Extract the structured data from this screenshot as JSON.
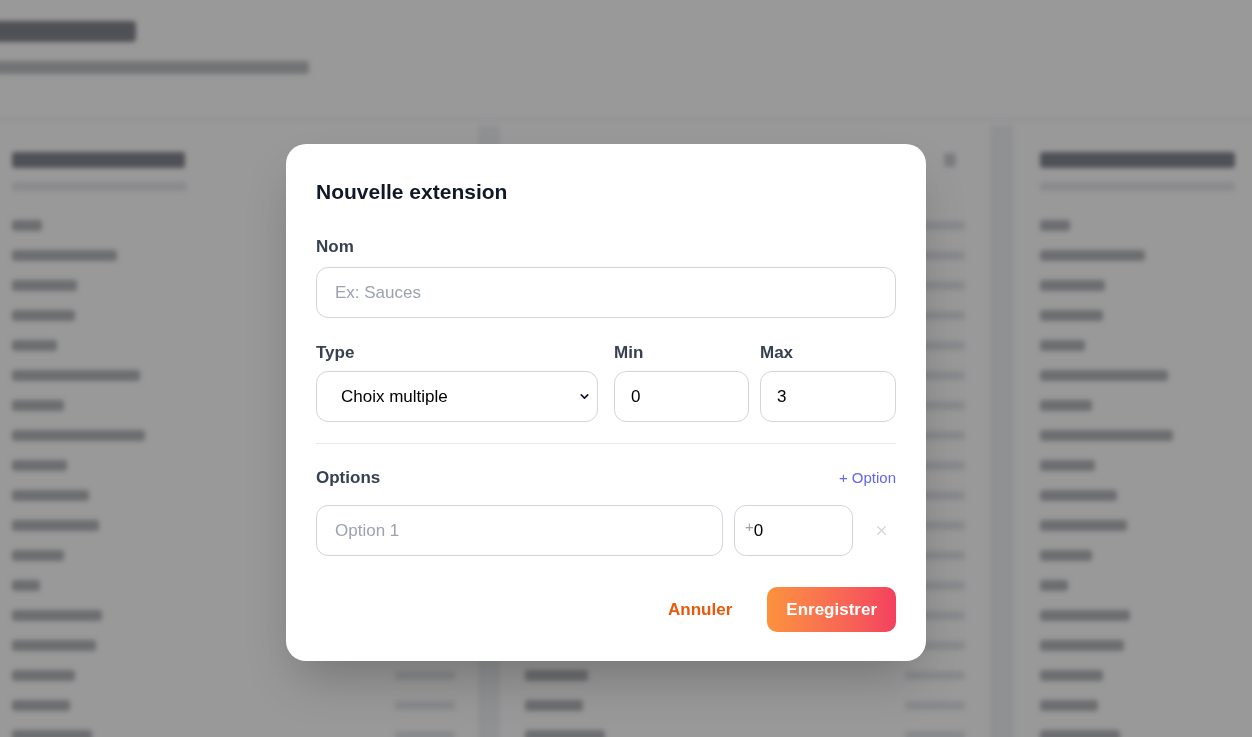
{
  "dialog": {
    "title": "Nouvelle extension",
    "name_field": {
      "label": "Nom",
      "placeholder": "Ex: Sauces"
    },
    "type_field": {
      "label": "Type",
      "value": "Choix multiple"
    },
    "min_field": {
      "label": "Min",
      "value": "0"
    },
    "max_field": {
      "label": "Max",
      "value": "3"
    },
    "options": {
      "label": "Options",
      "add_link": "+ Option",
      "rows": [
        {
          "placeholder": "Option 1",
          "price_prefix": "+",
          "price": "0"
        }
      ]
    },
    "buttons": [
      {
        "label": "Annuler",
        "kind": "text"
      },
      {
        "label": "Enregistrer",
        "kind": "filled"
      }
    ]
  }
}
